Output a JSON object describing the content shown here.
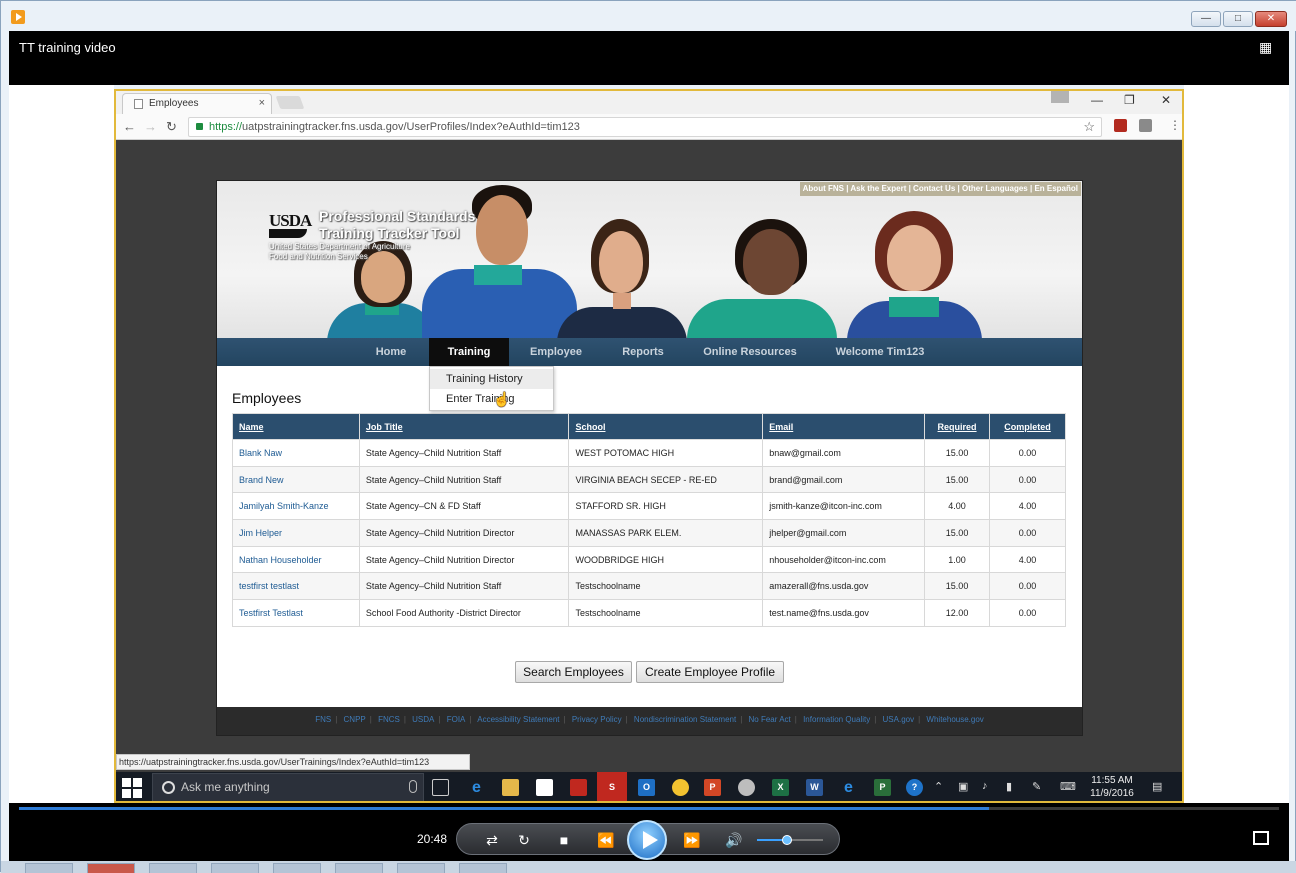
{
  "player": {
    "title": "TT training video",
    "timecode": "20:48",
    "progress": 0.77,
    "volume": 0.45
  },
  "browser": {
    "tab_title": "Employees",
    "url_scheme": "https://",
    "url_host": "uatpstrainingtracker.fns.usda.gov",
    "url_path": "/UserProfiles/Index?eAuthId=tim123",
    "status_url": "https://uatpstrainingtracker.fns.usda.gov/UserTrainings/Index?eAuthId=tim123"
  },
  "site": {
    "top_links": "About FNS | Ask the Expert | Contact Us | Other Languages | En Español",
    "logo": "USDA",
    "title_line1": "Professional Standards",
    "title_line2": "Training Tracker Tool",
    "sub_line1": "United States Department of Agriculture",
    "sub_line2": "Food and Nutrition Services"
  },
  "nav": {
    "home": "Home",
    "training": "Training",
    "employee": "Employee",
    "reports": "Reports",
    "online_resources": "Online Resources",
    "welcome": "Welcome Tim123"
  },
  "dropdown": {
    "training_history": "Training History",
    "enter_training": "Enter Training"
  },
  "main": {
    "section_title": "Employees",
    "columns": [
      "Name",
      "Job Title",
      "School",
      "Email",
      "Required",
      "Completed"
    ],
    "rows": [
      [
        "Blank Naw",
        "State Agency–Child Nutrition Staff",
        "WEST POTOMAC HIGH",
        "bnaw@gmail.com",
        "15.00",
        "0.00"
      ],
      [
        "Brand New",
        "State Agency–Child Nutrition Staff",
        "VIRGINIA BEACH SECEP - RE-ED",
        "brand@gmail.com",
        "15.00",
        "0.00"
      ],
      [
        "Jamilyah Smith-Kanze",
        "State Agency–CN & FD Staff",
        "STAFFORD SR. HIGH",
        "jsmith-kanze@itcon-inc.com",
        "4.00",
        "4.00"
      ],
      [
        "Jim Helper",
        "State Agency–Child Nutrition Director",
        "MANASSAS PARK ELEM.",
        "jhelper@gmail.com",
        "15.00",
        "0.00"
      ],
      [
        "Nathan Householder",
        "State Agency–Child Nutrition Director",
        "WOODBRIDGE HIGH",
        "nhouseholder@itcon-inc.com",
        "1.00",
        "4.00"
      ],
      [
        "testfirst testlast",
        "State Agency–Child Nutrition Staff",
        "Testschoolname",
        "amazerall@fns.usda.gov",
        "15.00",
        "0.00"
      ],
      [
        "Testfirst Testlast",
        "School Food Authority -District Director",
        "Testschoolname",
        "test.name@fns.usda.gov",
        "12.00",
        "0.00"
      ]
    ],
    "search_button": "Search Employees",
    "create_button": "Create Employee Profile"
  },
  "footer_links": [
    "FNS",
    "CNPP",
    "FNCS",
    "USDA",
    "FOIA",
    "Accessibility Statement",
    "Privacy Policy",
    "Nondiscrimination Statement",
    "No Fear Act",
    "Information Quality",
    "USA.gov",
    "Whitehouse.gov"
  ],
  "taskbar": {
    "search_placeholder": "Ask me anything",
    "time": "11:55 AM",
    "date": "11/9/2016"
  }
}
